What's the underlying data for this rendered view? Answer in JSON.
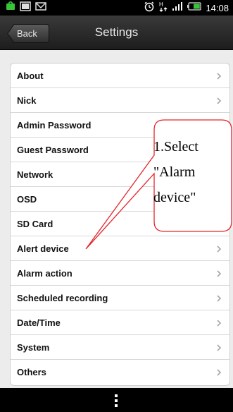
{
  "status_bar": {
    "time": "14:08",
    "left_icons": [
      "notification-icon",
      "gallery-icon",
      "mail-icon"
    ],
    "right_icons": [
      "alarm-icon",
      "data-transfer-icon",
      "signal-icon",
      "battery-icon"
    ]
  },
  "header": {
    "back_label": "Back",
    "title": "Settings"
  },
  "settings": {
    "items": [
      {
        "label": "About"
      },
      {
        "label": "Nick"
      },
      {
        "label": "Admin Password"
      },
      {
        "label": "Guest Password"
      },
      {
        "label": "Network"
      },
      {
        "label": "OSD"
      },
      {
        "label": "SD Card"
      },
      {
        "label": "Alert device"
      },
      {
        "label": "Alarm action"
      },
      {
        "label": "Scheduled recording"
      },
      {
        "label": "Date/Time"
      },
      {
        "label": "System"
      },
      {
        "label": "Others"
      }
    ]
  },
  "annotation": {
    "line1": "1.Select",
    "line2": "\"Alarm",
    "line3": "device\""
  },
  "colors": {
    "accent_callout": "#e4262b",
    "header_bg": "#2b2b2b",
    "list_bg": "#ffffff",
    "page_bg": "#ececec"
  }
}
